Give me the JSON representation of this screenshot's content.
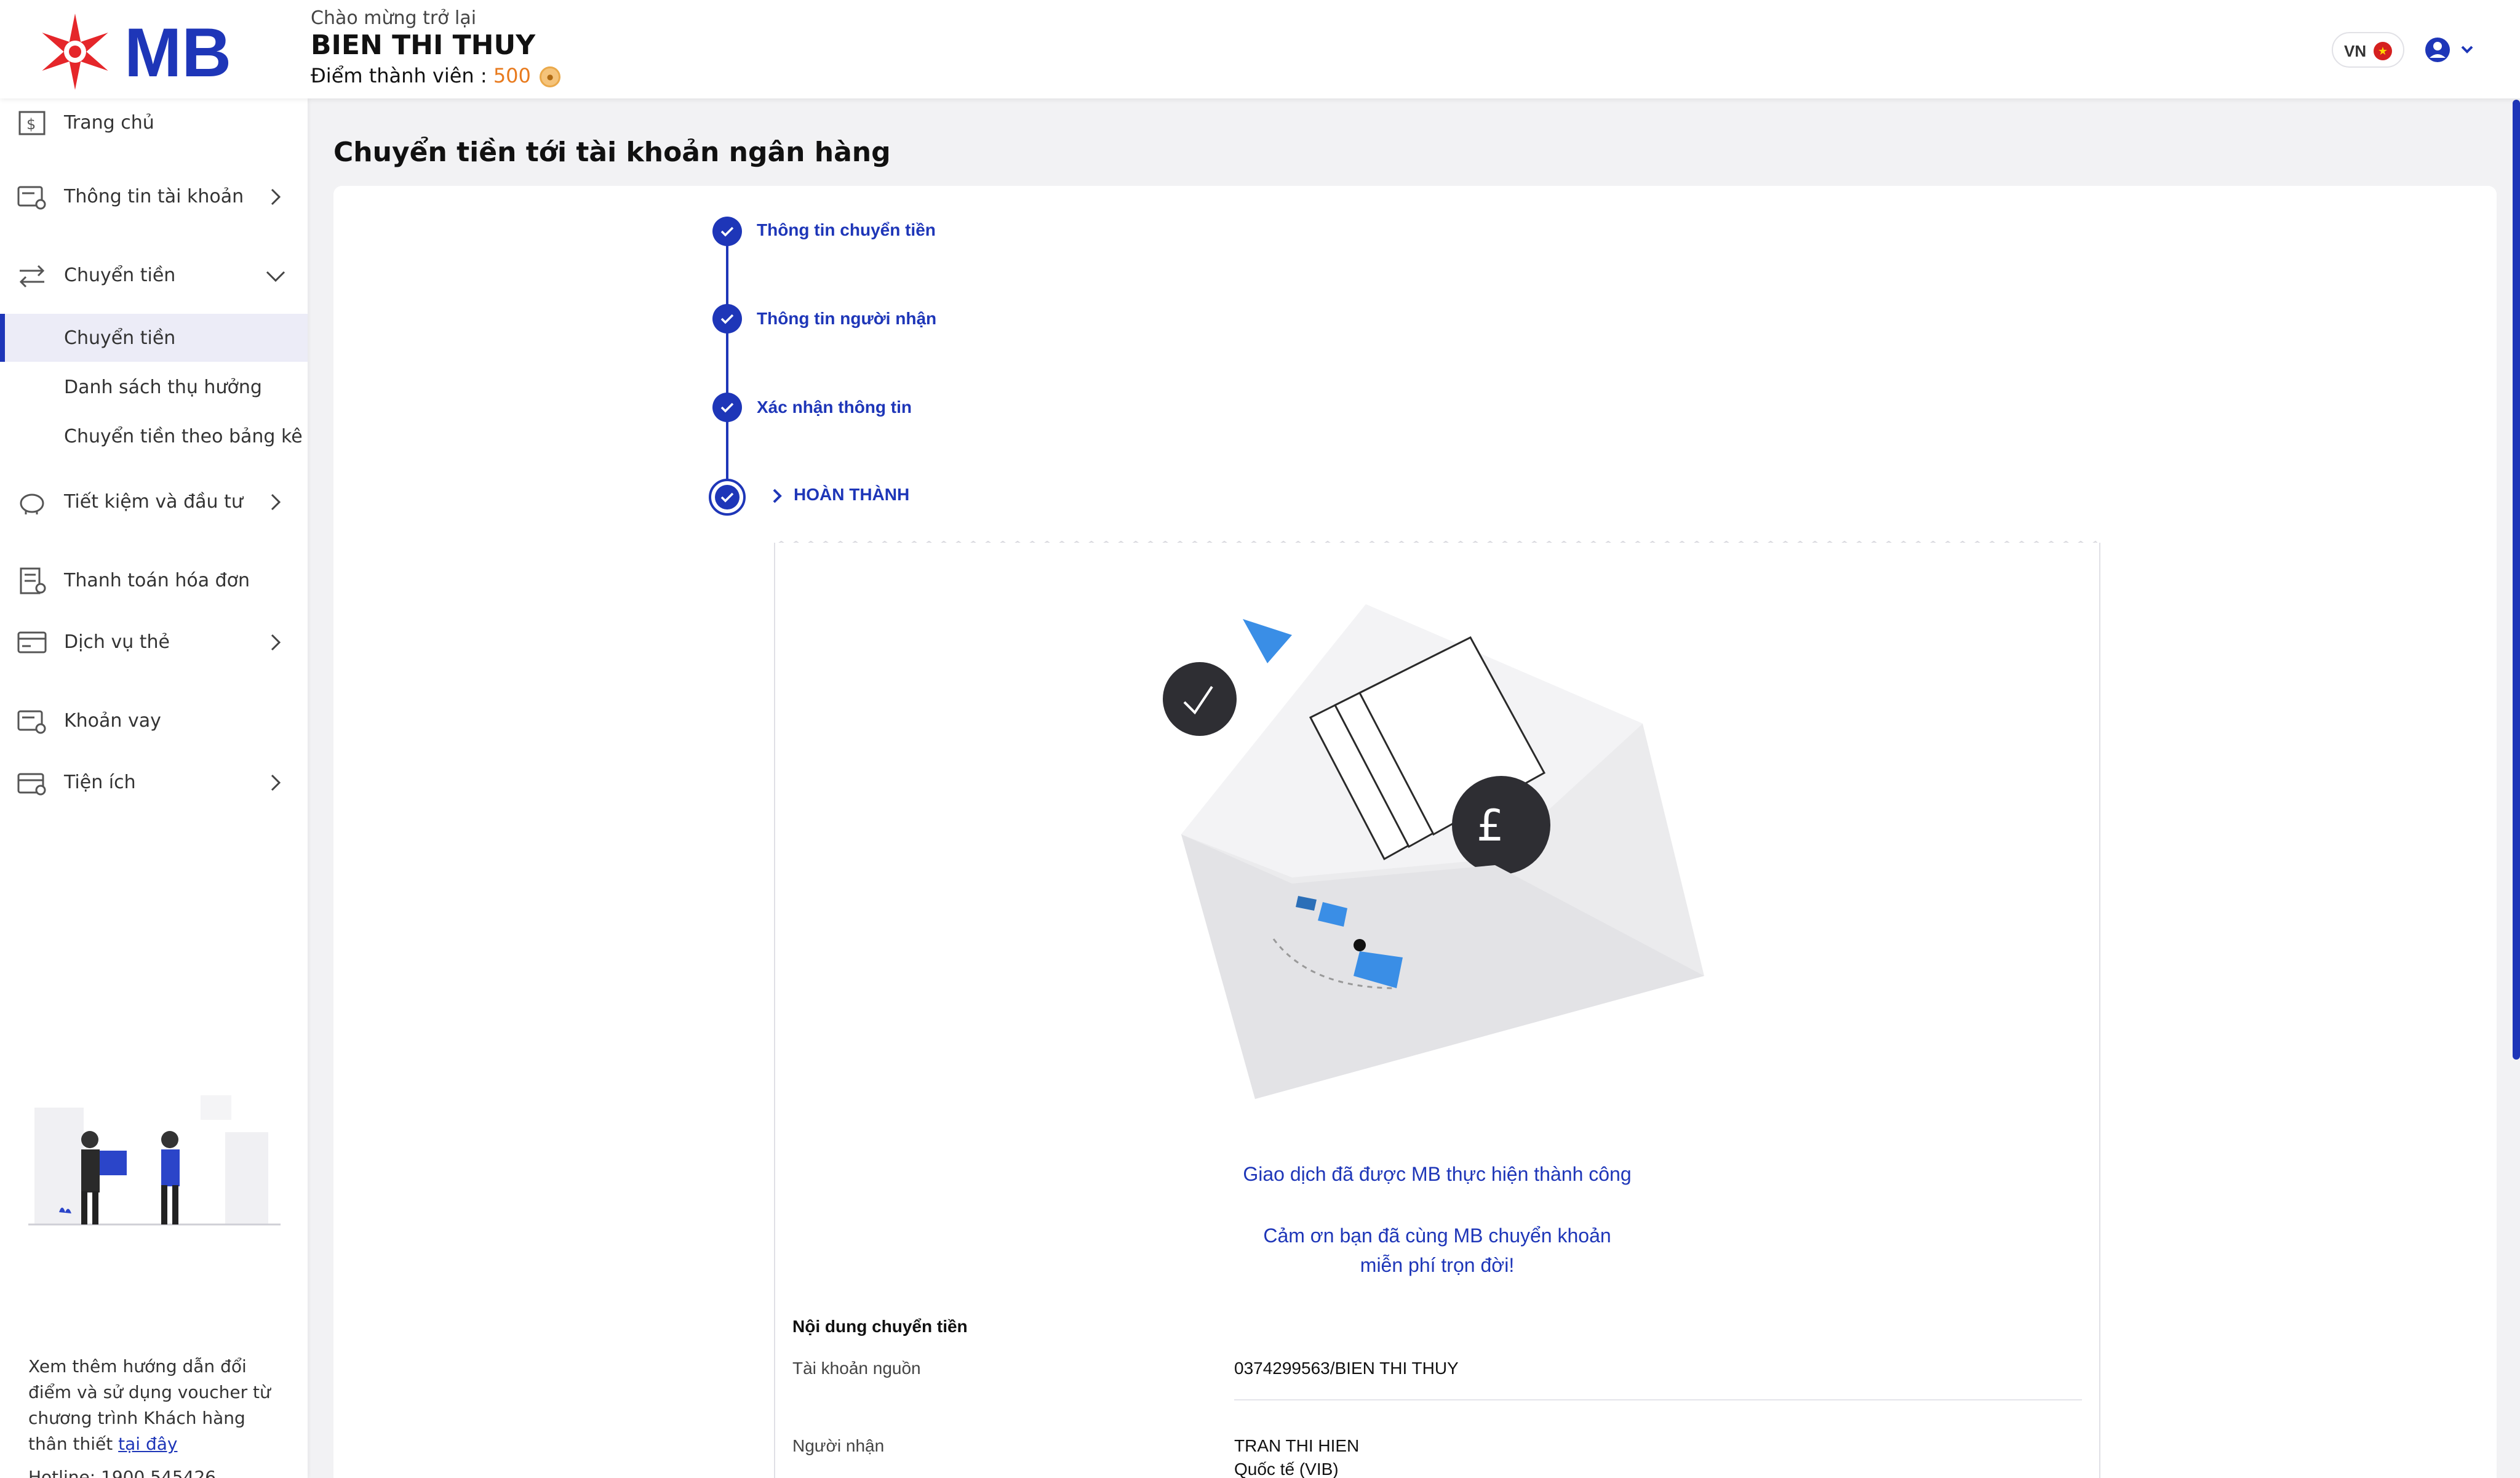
{
  "header": {
    "greeting": "Chào mừng trở lại",
    "user_name": "BIEN THI THUY",
    "points_label": "Điểm thành viên : ",
    "points_value": "500",
    "language": "VN"
  },
  "sidebar": {
    "items": [
      {
        "label": "Trang chủ",
        "icon": "bank-icon"
      },
      {
        "label": "Thông tin tài khoản",
        "icon": "account-info-icon"
      },
      {
        "label": "Chuyển tiền",
        "icon": "transfer-icon"
      },
      {
        "label": "Tiết kiệm và đầu tư",
        "icon": "piggy-bank-icon"
      },
      {
        "label": "Thanh toán hóa đơn",
        "icon": "bill-icon"
      },
      {
        "label": "Dịch vụ thẻ",
        "icon": "card-icon"
      },
      {
        "label": "Khoản vay",
        "icon": "loan-icon"
      },
      {
        "label": "Tiện ích",
        "icon": "utilities-icon"
      }
    ],
    "sub_items": [
      "Chuyển tiền",
      "Danh sách thụ hưởng",
      "Chuyển tiền theo bảng kê"
    ],
    "promo_text": "Xem thêm hướng dẫn đổi điểm và sử dụng voucher từ chương trình Khách hàng thân thiết ",
    "promo_link": "tại đây",
    "hotline": "Hotline: 1900 545426"
  },
  "main": {
    "title": "Chuyển tiền tới tài khoản ngân hàng",
    "steps": [
      "Thông tin chuyển tiền",
      "Thông tin người nhận",
      "Xác nhận thông tin",
      "HOÀN THÀNH"
    ],
    "success_message": "Giao dịch đã được MB thực hiện thành công",
    "thanks_line1": "Cảm ơn bạn đã cùng MB chuyển khoản",
    "thanks_line2": "miễn phí trọn đời!",
    "details_title": "Nội dung chuyển tiền",
    "details": [
      {
        "label": "Tài khoản nguồn",
        "value": "0374299563/BIEN THI THUY"
      },
      {
        "label": "Người nhận",
        "value": "TRAN THI HIEN",
        "value2": "Quốc tế (VIB)"
      }
    ]
  },
  "colors": {
    "brand": "#1e36b8",
    "logo_red": "#e5262a",
    "points": "#e87a1d"
  }
}
